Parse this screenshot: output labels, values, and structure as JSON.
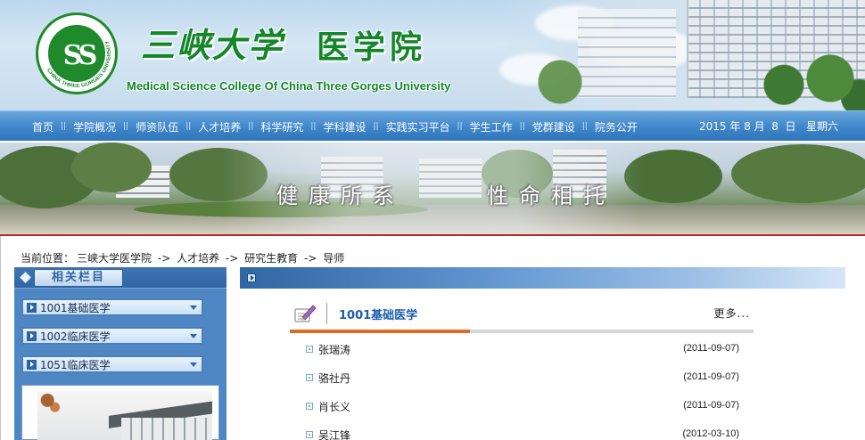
{
  "header": {
    "logo_mark": "SS",
    "logo_ring_text": "CHINA THREE GORGES UNIVERSITY",
    "school_name": "三峡大学",
    "college_name": "医学院",
    "english_name": "Medical Science College Of China Three Gorges University"
  },
  "nav": {
    "items": [
      "首页",
      "学院概况",
      "师资队伍",
      "人才培养",
      "科学研究",
      "学科建设",
      "实践实习平台",
      "学生工作",
      "党群建设",
      "院务公开"
    ],
    "separator": "||",
    "date": "2015 年 8 月  8  日   星期六"
  },
  "banner": {
    "slogan_left": "健康所系",
    "slogan_right": "性命相托"
  },
  "breadcrumb": {
    "prefix": "当前位置：",
    "items": [
      "三峡大学医学院",
      "人才培养",
      "研究生教育",
      "导师"
    ],
    "separator": "->"
  },
  "sidebar": {
    "title": "相关栏目",
    "categories": [
      {
        "label": "1001基础医学"
      },
      {
        "label": "1002临床医学"
      },
      {
        "label": "1051临床医学"
      }
    ]
  },
  "list": {
    "title": "1001基础医学",
    "more_label": "更多...",
    "items": [
      {
        "name": "张瑞涛",
        "date": "(2011-09-07)"
      },
      {
        "name": "骆社丹",
        "date": "(2011-09-07)"
      },
      {
        "name": "肖长义",
        "date": "(2011-09-07)"
      },
      {
        "name": "吴江锋",
        "date": "(2012-03-10)"
      }
    ]
  },
  "colors": {
    "brand_green": "#13862a",
    "nav_blue": "#3f86cb",
    "accent_orange": "#e06a1f",
    "title_blue": "#1a5cb0",
    "divider_red": "#b22b2b"
  }
}
